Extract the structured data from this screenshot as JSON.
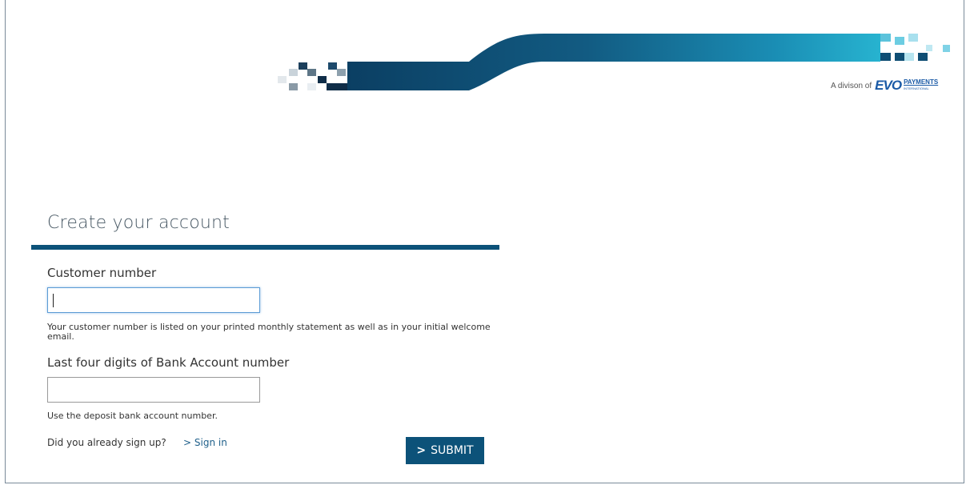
{
  "header": {
    "tagline": "A divison of",
    "brand_mark": "EVO",
    "brand_word": "PAYMENTS",
    "brand_sub": "INTERNATIONAL"
  },
  "form": {
    "title": "Create your account",
    "customer_number": {
      "label": "Customer number",
      "value": "",
      "hint": "Your customer number is listed on your printed monthly statement as well as in your initial welcome email."
    },
    "bank_account": {
      "label": "Last four digits of Bank Account number",
      "value": "",
      "hint": "Use the deposit bank account number."
    },
    "already_signed_up": "Did you already sign up?",
    "sign_in_link": "> Sign in",
    "submit_label": "SUBMIT",
    "submit_icon": ">"
  },
  "colors": {
    "primary": "#0c5279",
    "accent_teal": "#21a9c9",
    "link": "#1e5f8a"
  }
}
